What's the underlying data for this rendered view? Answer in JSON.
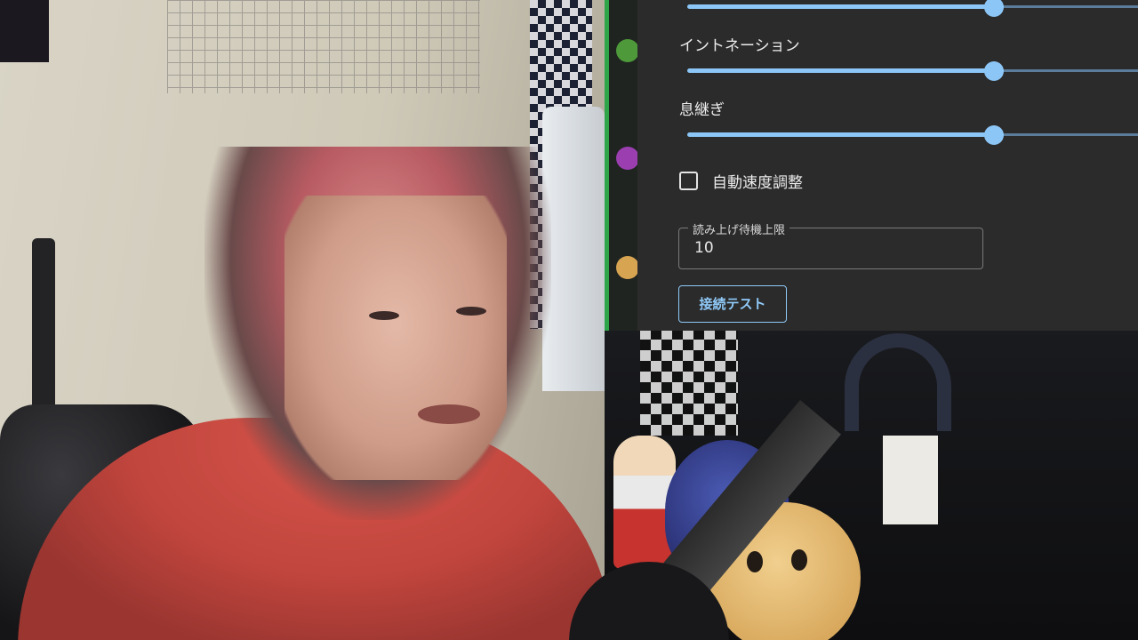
{
  "settings": {
    "sliders": [
      {
        "label": "",
        "value_fraction": 0.68
      },
      {
        "label": "イントネーション",
        "value_fraction": 0.68
      },
      {
        "label": "息継ぎ",
        "value_fraction": 0.68
      }
    ],
    "auto_speed": {
      "label": "自動速度調整",
      "checked": false
    },
    "wait_limit": {
      "legend": "読み上げ待機上限",
      "value": "10"
    },
    "connect_test_button": "接続テスト"
  },
  "colors": {
    "panel_bg": "#2b2b2b",
    "accent": "#90caf9",
    "sidebar_active": "#2fa54a"
  }
}
